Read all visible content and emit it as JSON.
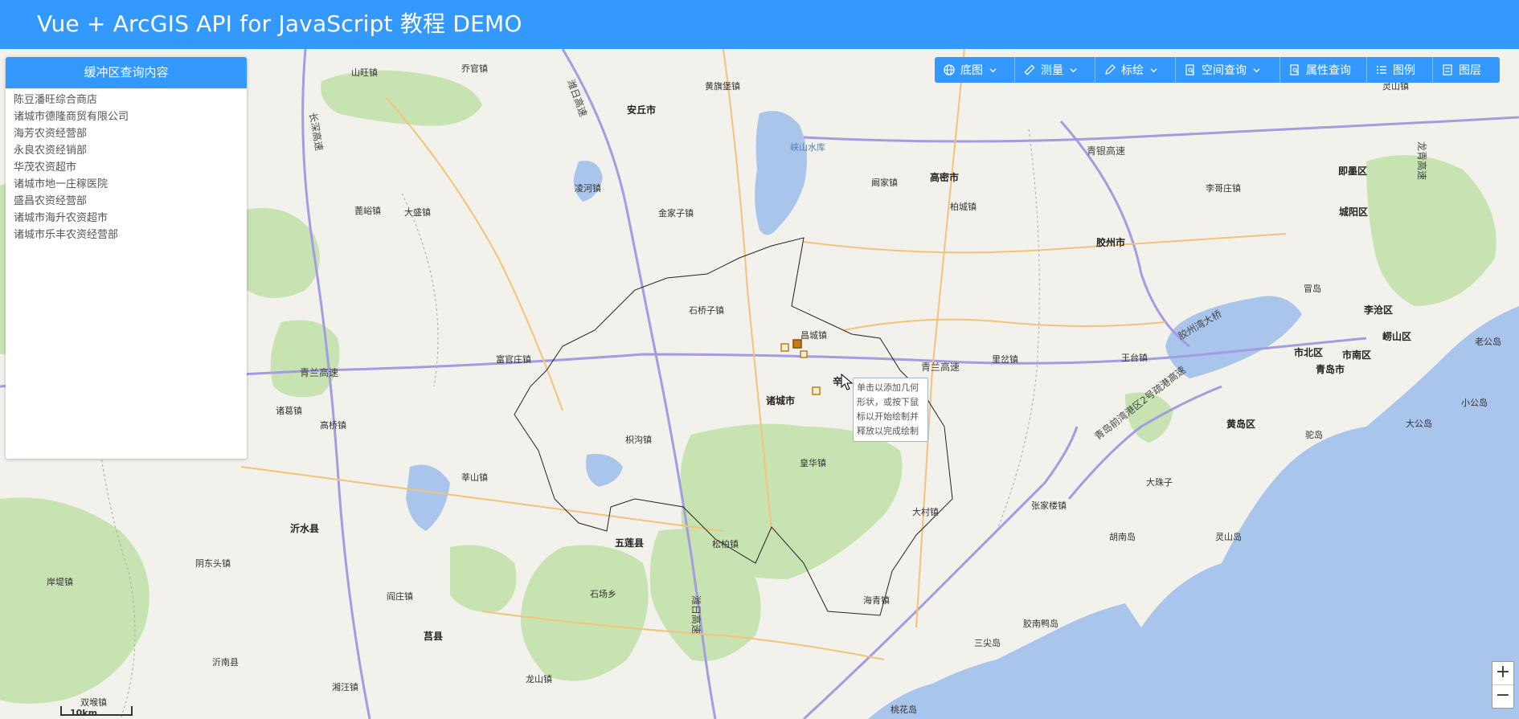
{
  "header": {
    "title": "Vue + ArcGIS API for JavaScript 教程 DEMO"
  },
  "panel": {
    "title": "缓冲区查询内容",
    "items": [
      "陈豆潘旺综合商店",
      "诸城市德隆商贸有限公司",
      "海芳农资经营部",
      "永良农资经销部",
      "华茂农资超市",
      "诸城市地一庄稼医院",
      "盛昌农资经营部",
      "诸城市海升农资超市",
      "诸城市乐丰农资经营部"
    ]
  },
  "toolbar": {
    "basemap": "底图",
    "measure": "测量",
    "draw": "标绘",
    "spatial_query": "空间查询",
    "attr_query": "属性查询",
    "legend": "图例",
    "layers": "图层"
  },
  "tooltip": {
    "text": "单击以添加几何形状，或按下鼠标以开始绘制并释放以完成绘制"
  },
  "zoom": {
    "in": "+",
    "out": "−"
  },
  "scale": {
    "label": "10km"
  },
  "map_labels": {
    "shanwang": "山旺镇",
    "qiaoguan": "乔官镇",
    "anqiu": "安丘市",
    "huangqi": "黄旗堡镇",
    "xiashan": "峡山水库",
    "qingyin": "青银高速",
    "gaomi": "高密市",
    "lanjia": "阚家镇",
    "jimo": "即墨区",
    "lingshan": "灵山镇",
    "chengyang": "城阳区",
    "lige": "李哥庄镇",
    "jiaozhou": "胶州市",
    "baicheng": "柏城镇",
    "linghe": "凌河镇",
    "jinjiazhuang": "金家子镇",
    "dasheng": "大盛镇",
    "bailu": "蓖峪镇",
    "shiqiaozi": "石桥子镇",
    "changcheng": "昌城镇",
    "fuguanzhuang": "富官庄镇",
    "qinglan_w": "青兰高速",
    "qinglan_e": "青兰高速",
    "zhucheng": "诸城市",
    "ligu": "里岔镇",
    "wangtai": "王台镇",
    "jiaozhouwan": "胶州湾大桥",
    "maodao": "冒岛",
    "licang": "李沧区",
    "laoshan": "崂山区",
    "shibei": "市北区",
    "shinan": "市南区",
    "qingdao": "青岛市",
    "laogong": "老公岛",
    "xiaogong": "小公岛",
    "dagong": "大公岛",
    "huangdao": "黄岛区",
    "tuodao": "驼岛",
    "qingdaohx": "青岛前湾港区2号疏港高速",
    "zhuge": "诸葛镇",
    "gaoqiao": "高桥镇",
    "zhigou": "枳沟镇",
    "huangua": "皇华镇",
    "xinshan": "莘山镇",
    "dacun": "大村镇",
    "zhangjialou": "张家楼镇",
    "dazhuzi": "大珠子",
    "huwen": "胡南岛",
    "lingshandao": "灵山岛",
    "yishui": "沂水县",
    "yiyuan": "阴东头镇",
    "anxiang": "岸堤镇",
    "wulian": "五莲县",
    "songbai": "松柏镇",
    "shichang": "石场乡",
    "yanzhuang": "阎庄镇",
    "haiqing": "海青镇",
    "junan": "莒县",
    "longshan": "龙山镇",
    "yinan": "沂南县",
    "shuangdui": "双堠镇",
    "yangzhuang": "湘汪镇",
    "taohua": "桃花岛",
    "sanjiao": "三尖岛",
    "jiaonan": "胶南鸭岛",
    "changshen": "长深高速",
    "rilan_n": "潍日高速",
    "rilan_s": "潍日高速",
    "longqing": "龙青高速",
    "xin": "辛"
  }
}
